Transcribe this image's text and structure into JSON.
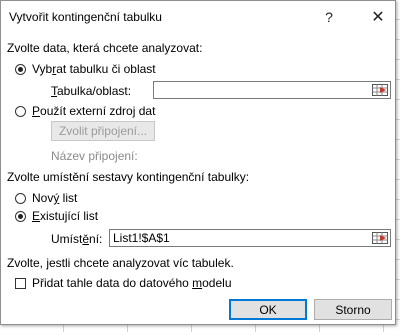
{
  "dialog": {
    "title": "Vytvořit kontingenční tabulku",
    "help_glyph": "?",
    "close_glyph": "✕"
  },
  "source_section": {
    "label": "Zvolte data, která chcete analyzovat:",
    "option_table": {
      "pre": "Vyb",
      "u": "r",
      "post": "at tabulku či oblast",
      "checked": true
    },
    "table_range_label": {
      "u": "T",
      "post": "abulka/oblast:"
    },
    "table_range_value": "",
    "option_external": {
      "pre": "",
      "u": "P",
      "post": "oužít externí zdroj dat",
      "checked": false
    },
    "choose_connection_button": "Zvolit připojení...",
    "connection_name_label": "Název připojení:"
  },
  "location_section": {
    "label": "Zvolte umístění sestavy kontingenční tabulky:",
    "option_new": {
      "pre": "Nov",
      "u": "ý",
      "post": " list",
      "checked": false
    },
    "option_existing": {
      "pre": "",
      "u": "E",
      "post": "xistující list",
      "checked": true
    },
    "location_label": {
      "pre": "Umíst",
      "u": "ě",
      "post": "ní:"
    },
    "location_value": "List1!$A$1"
  },
  "multiple_section": {
    "label": "Zvolte, jestli chcete analyzovat víc tabulek.",
    "add_to_model": {
      "pre": "Přidat tahle data do datového ",
      "u": "m",
      "post": "odelu",
      "checked": false
    }
  },
  "buttons": {
    "ok": "OK",
    "cancel": "Storno"
  },
  "colors": {
    "range_icon_red": "#c0392b",
    "primary_border": "#0078d7"
  }
}
